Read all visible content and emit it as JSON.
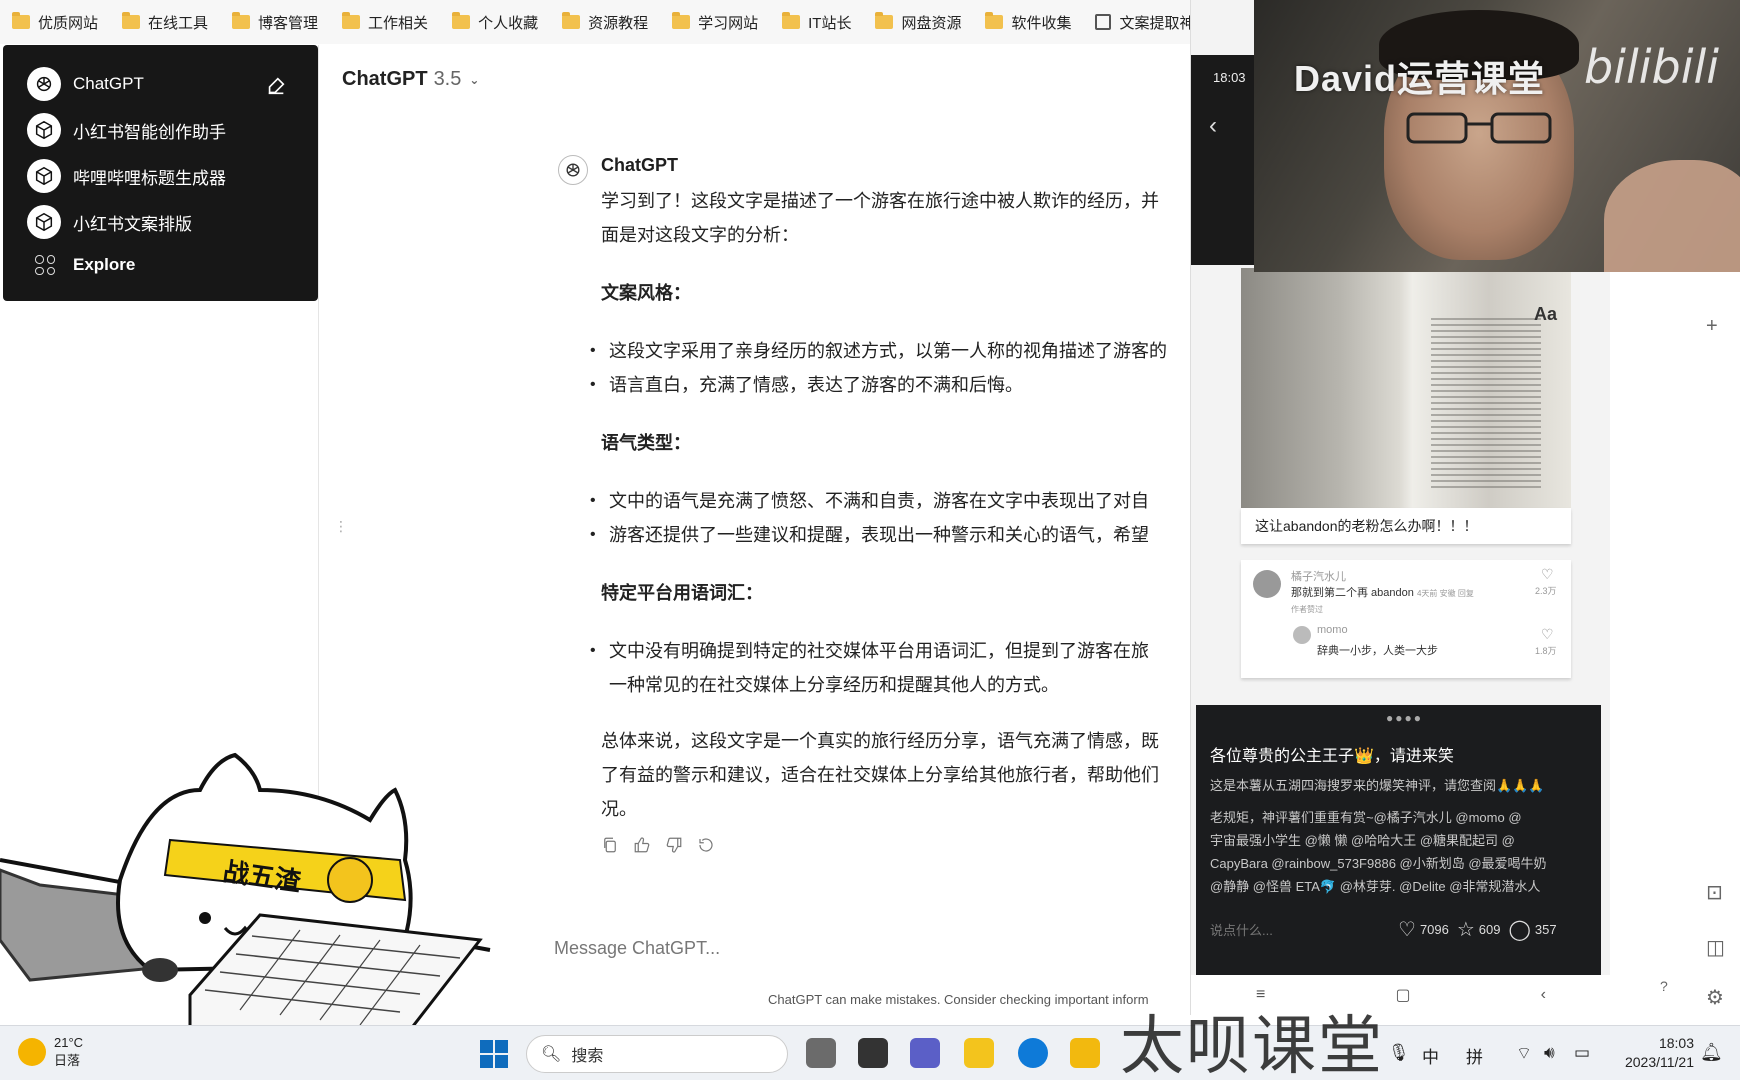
{
  "bookmarks": [
    "优质网站",
    "在线工具",
    "博客管理",
    "工作相关",
    "个人收藏",
    "资源教程",
    "学习网站",
    "IT站长",
    "网盘资源",
    "软件收集",
    "文案提取神器"
  ],
  "sidebar": {
    "items": [
      {
        "label": "ChatGPT",
        "icon": "openai-logo-icon"
      },
      {
        "label": "小红书智能创作助手",
        "icon": "cube-icon"
      },
      {
        "label": "哔哩哔哩标题生成器",
        "icon": "cube-icon"
      },
      {
        "label": "小红书文案排版",
        "icon": "cube-icon"
      },
      {
        "label": "Explore",
        "icon": "grid-icon"
      }
    ]
  },
  "header": {
    "model": "ChatGPT",
    "version": "3.5"
  },
  "message": {
    "author": "ChatGPT",
    "intro1": "学习到了！这段文字是描述了一个游客在旅行途中被人欺诈的经历，并",
    "intro2": "面是对这段文字的分析：",
    "h1": "文案风格：",
    "b1": "这段文字采用了亲身经历的叙述方式，以第一人称的视角描述了游客的",
    "b2": "语言直白，充满了情感，表达了游客的不满和后悔。",
    "h2": "语气类型：",
    "b3": "文中的语气是充满了愤怒、不满和自责，游客在文字中表现出了对自",
    "b4": "游客还提供了一些建议和提醒，表现出一种警示和关心的语气，希望",
    "h3": "特定平台用语词汇：",
    "b5a": "文中没有明确提到特定的社交媒体平台用语词汇，但提到了游客在旅",
    "b5b": "一种常见的在社交媒体上分享经历和提醒其他人的方式。",
    "c1": "总体来说，这段文字是一个真实的旅行经历分享，语气充满了情感，既",
    "c2": "了有益的警示和建议，适合在社交媒体上分享给其他旅行者，帮助他们",
    "c3": "况。"
  },
  "composer": {
    "placeholder": "Message ChatGPT...",
    "disclaimer": "ChatGPT can make mistakes. Consider checking important inform"
  },
  "sticker": {
    "band_text": "战五渣"
  },
  "phone": {
    "time": "18:03",
    "card_caption": "这让abandon的老粉怎么办啊！！！",
    "comment1": {
      "name": "橘子汽水儿",
      "text": "那就到第二个再 abandon",
      "meta": "4天前 安徽 回复",
      "likes": "2.3万",
      "tag": "作者赞过"
    },
    "comment2": {
      "name": "momo",
      "text": "辞典一小步，人类一大步",
      "likes": "1.8万"
    },
    "post_title": "各位尊贵的公主王子👑，请进来笑",
    "post_lines": [
      "这是本薯从五湖四海搜罗来的爆笑神评，请您查阅🙏🙏🙏",
      "老规矩，神评薯们重重有赏~@橘子汽水儿 @momo @",
      "宇宙最强小学生 @懒 懒 @哈哈大王 @糖果配起司 @",
      "CapyBara @rainbow_573F9886 @小新划岛 @最爱喝牛奶",
      "@静静 @怪兽 ETA🐬 @林芽芽. @Delite @非常规潜水人"
    ],
    "say_placeholder": "说点什么...",
    "likes": "7096",
    "stars": "609",
    "comments": "357"
  },
  "cam": {
    "title": "David运营课堂",
    "logo": "bilibili"
  },
  "taskbar": {
    "temp": "21°C",
    "weather": "日落",
    "search_placeholder": "搜索",
    "ime1": "中",
    "ime2": "拼",
    "time": "18:03",
    "date": "2023/11/21",
    "watermark": "太呗课堂"
  }
}
